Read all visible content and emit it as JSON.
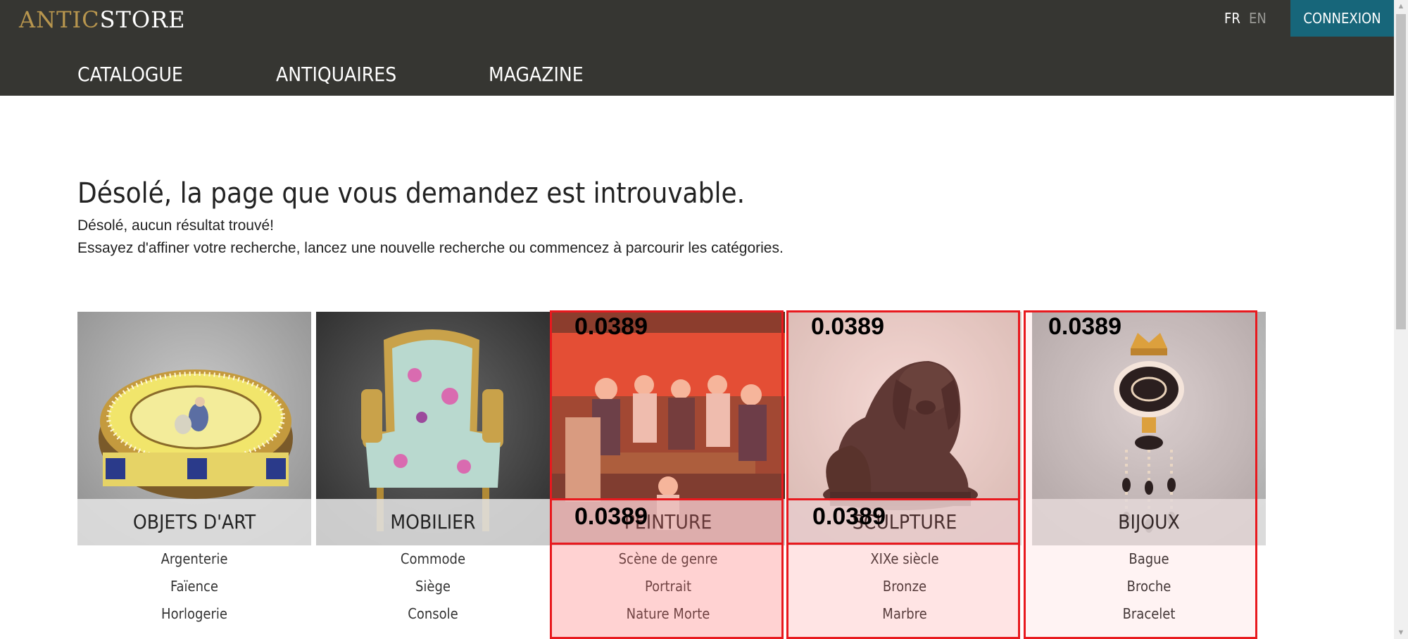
{
  "header": {
    "logo": {
      "part1": "ANTIC",
      "part2": "STORE"
    },
    "languages": [
      {
        "code": "FR",
        "active": true
      },
      {
        "code": "EN",
        "active": false
      }
    ],
    "login_label": "CONNEXION",
    "nav": [
      "CATALOGUE",
      "ANTIQUAIRES",
      "MAGAZINE"
    ]
  },
  "error": {
    "title": "Désolé, la page que vous demandez est introuvable.",
    "line1": "Désolé, aucun résultat trouvé!",
    "line2": "Essayez d'affiner votre recherche, lancez une nouvelle recherche ou commencez à parcourir les catégories."
  },
  "categories": [
    {
      "label": "OBJETS D'ART",
      "items": [
        "Argenterie",
        "Faïence",
        "Horlogerie"
      ]
    },
    {
      "label": "MOBILIER",
      "items": [
        "Commode",
        "Siège",
        "Console"
      ]
    },
    {
      "label": "PEINTURE",
      "items": [
        "Scène de genre",
        "Portrait",
        "Nature Morte"
      ]
    },
    {
      "label": "SCULPTURE",
      "items": [
        "XIXe siècle",
        "Bronze",
        "Marbre"
      ]
    },
    {
      "label": "BIJOUX",
      "items": [
        "Bague",
        "Broche",
        "Bracelet"
      ]
    }
  ],
  "overlays": {
    "scores": [
      "0.0389",
      "0.0389",
      "0.0389",
      "0.0389",
      "0.0389"
    ],
    "box_color": "#e8191e",
    "fill_color": "#ff6b6b"
  },
  "colors": {
    "header_bg": "#363632",
    "logo_gold": "#b8964e",
    "login_bg": "#17667a"
  }
}
